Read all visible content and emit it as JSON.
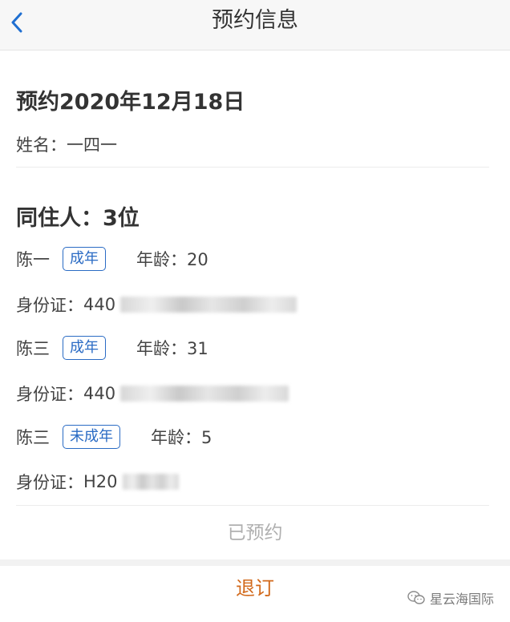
{
  "nav": {
    "title": "预约信息"
  },
  "booking": {
    "date_heading": "预约2020年12月18日",
    "name_label": "姓名：",
    "name_value": "一四一"
  },
  "companions": {
    "heading": "同住人：3位",
    "id_label": "身份证：",
    "age_label": "年龄：",
    "guests": [
      {
        "name": "陈一",
        "badge": "成年",
        "age": "20",
        "id_prefix": "440"
      },
      {
        "name": "陈三",
        "badge": "成年",
        "age": "31",
        "id_prefix": "440"
      },
      {
        "name": "陈三",
        "badge": "未成年",
        "age": "5",
        "id_prefix": "H20"
      }
    ]
  },
  "status": {
    "text": "已预约"
  },
  "actions": {
    "cancel_label": "退订"
  },
  "watermark": {
    "text": "星云海国际"
  },
  "colors": {
    "badge_blue": "#2a6bc4",
    "cancel_orange": "#d26a1c",
    "status_gray": "#b0b0b0"
  }
}
